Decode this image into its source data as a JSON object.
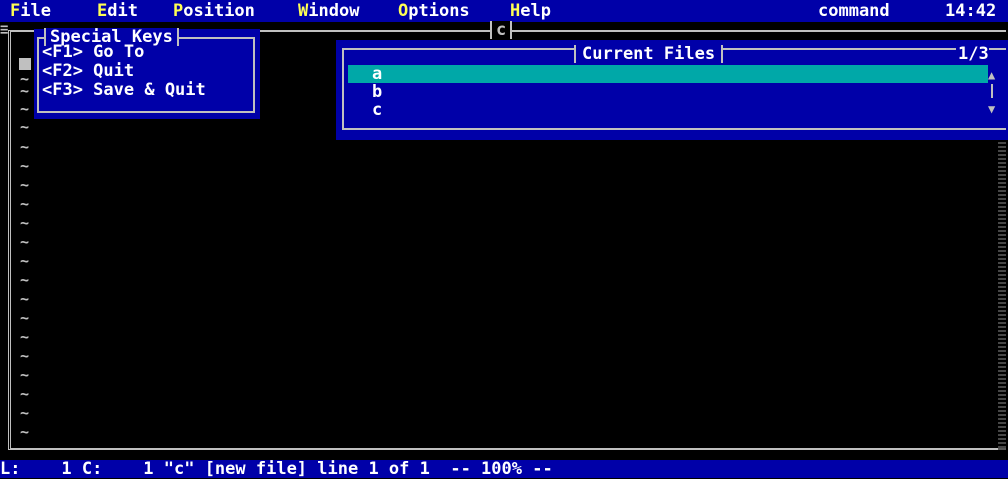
{
  "menubar": {
    "items": [
      {
        "hot": "F",
        "rest": "ile"
      },
      {
        "hot": "E",
        "rest": "dit"
      },
      {
        "hot": "P",
        "rest": "osition"
      },
      {
        "hot": "W",
        "rest": "indow"
      },
      {
        "hot": "O",
        "rest": "ptions"
      },
      {
        "hot": "H",
        "rest": "elp"
      }
    ],
    "mode": "command",
    "time": "14:42"
  },
  "editor": {
    "title": "c",
    "tilde": "~"
  },
  "special_keys": {
    "title": "Special Keys",
    "lines": [
      "<F1> Go To",
      "<F2> Quit",
      "<F3> Save & Quit"
    ]
  },
  "current_files": {
    "title": "Current Files",
    "count": "1/3",
    "files": [
      "a",
      "b",
      "c"
    ],
    "selected_index": 0
  },
  "status": {
    "text": "L:    1 C:    1 \"c\" [new file] line 1 of 1  -- 100% --"
  },
  "colors": {
    "menu_bg": "#0000a8",
    "hotkey": "#ffff54",
    "selection": "#00a8a8",
    "text": "#c0c0c0"
  }
}
